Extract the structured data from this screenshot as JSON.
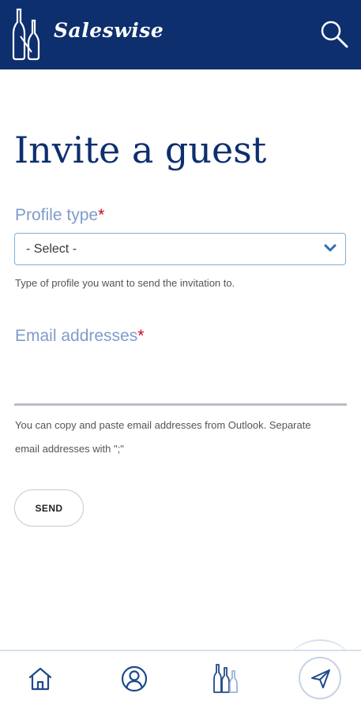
{
  "header": {
    "app_name": "Saleswise",
    "logo_icon": "wine-bottles-logo-icon",
    "search_icon": "search-icon"
  },
  "page": {
    "title": "Invite a guest"
  },
  "form": {
    "profile_type": {
      "label": "Profile type",
      "required_mark": "*",
      "selected": "- Select -",
      "helper": "Type of profile you want to send the invitation to."
    },
    "email": {
      "label": "Email addresses",
      "required_mark": "*",
      "value": "",
      "helper_line1": "You can copy and paste email addresses from Outlook. Separate",
      "helper_line2": "email addresses with \";\""
    },
    "send_label": "SEND"
  },
  "bottom_nav": {
    "items": [
      {
        "icon": "home-icon"
      },
      {
        "icon": "user-profile-icon"
      },
      {
        "icon": "wine-bottles-icon"
      },
      {
        "icon": "send-icon"
      }
    ]
  },
  "colors": {
    "header_bg": "#0d2f6e",
    "title": "#0d2f6e",
    "label": "#7d9ccb",
    "required": "#d0021b",
    "select_border": "#7fb1d8",
    "icon": "#1f4a8a"
  }
}
